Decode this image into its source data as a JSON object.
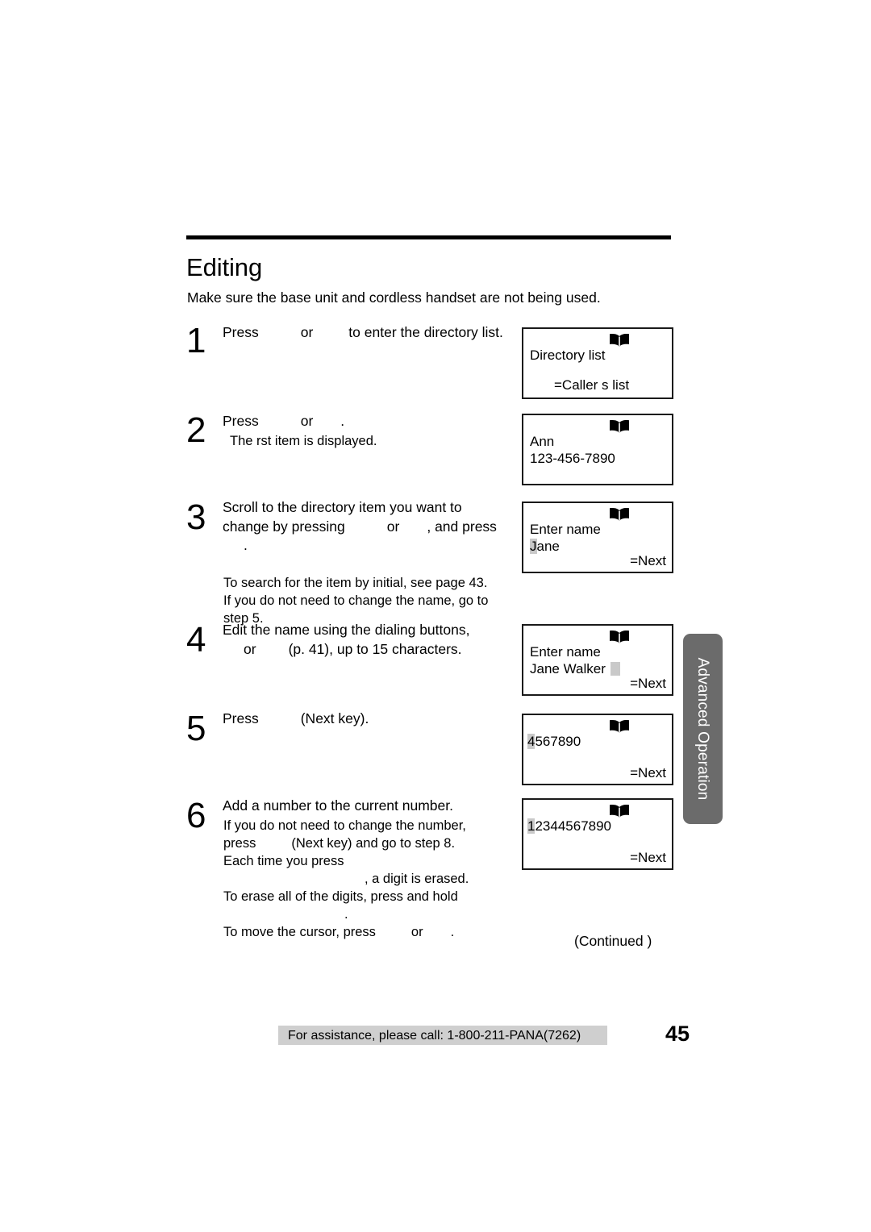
{
  "document": {
    "section_title": "Editing",
    "intro": "Make sure the base unit and cordless handset are not being used."
  },
  "steps": [
    {
      "number": "1",
      "lead_a": "Press",
      "lead_b": "or",
      "lead_c": "to enter the directory list."
    },
    {
      "number": "2",
      "lead_a": "Press",
      "lead_b": "or",
      "lead_c": ".",
      "sub_1": "The  rst item is displayed."
    },
    {
      "number": "3",
      "lead_a": "Scroll to the directory item you want to",
      "lead_b": "change by pressing",
      "lead_c": "or",
      "lead_d": ", and press",
      "lead_e": ".",
      "sub_1": "To search for the item by initial, see page 43.",
      "sub_2": "If you do not need to change the name, go to",
      "sub_3": "step 5."
    },
    {
      "number": "4",
      "lead_a": "Edit the name using the dialing buttons,",
      "lead_b": "or",
      "lead_c": "(p. 41), up to 15 characters."
    },
    {
      "number": "5",
      "lead_a": "Press",
      "lead_b": "(Next  key)."
    },
    {
      "number": "6",
      "lead_a": "Add a number to the current number.",
      "sub_1": "If you do not need to change the number,",
      "sub_2a": "press",
      "sub_2b": "(Next  key) and go to step 8.",
      "sub_3": "Each time you press",
      "sub_4": ", a digit is erased.",
      "sub_5": "To erase all of the digits, press and hold",
      "sub_6": ".",
      "sub_7a": "To move the cursor, press",
      "sub_7b": "or",
      "sub_7c": "."
    }
  ],
  "displays": [
    {
      "name": "directory-list",
      "line1": "Directory list",
      "caller": "=Caller s  list",
      "icon": "book-icon"
    },
    {
      "name": "first-item",
      "line1": "Ann",
      "line2": "123-456-7890",
      "icon": "book-icon"
    },
    {
      "name": "enter-name-jane",
      "line1": "Enter name",
      "cursor_char": "J",
      "line2_rest": "ane",
      "next": "=Next",
      "icon": "book-icon"
    },
    {
      "name": "enter-name-jane-walker",
      "line1": "Enter name",
      "line2": "Jane Walker",
      "next": "=Next",
      "icon": "book-icon"
    },
    {
      "name": "number-4567890",
      "cursor_char": "4",
      "line1_rest": "567890",
      "next": "=Next",
      "icon": "book-icon"
    },
    {
      "name": "number-12344567890",
      "cursor_char": "1",
      "line1_rest": "2344567890",
      "next": "=Next",
      "icon": "book-icon"
    }
  ],
  "side_tab": {
    "label": "Advanced Operation",
    "color": "#6b6b6b"
  },
  "continued": "(Continued     )",
  "footer": {
    "assistance": "For assistance, please call: 1-800-211-PANA(7262)",
    "page_number": "45",
    "bar_color": "#cfcfcf"
  }
}
